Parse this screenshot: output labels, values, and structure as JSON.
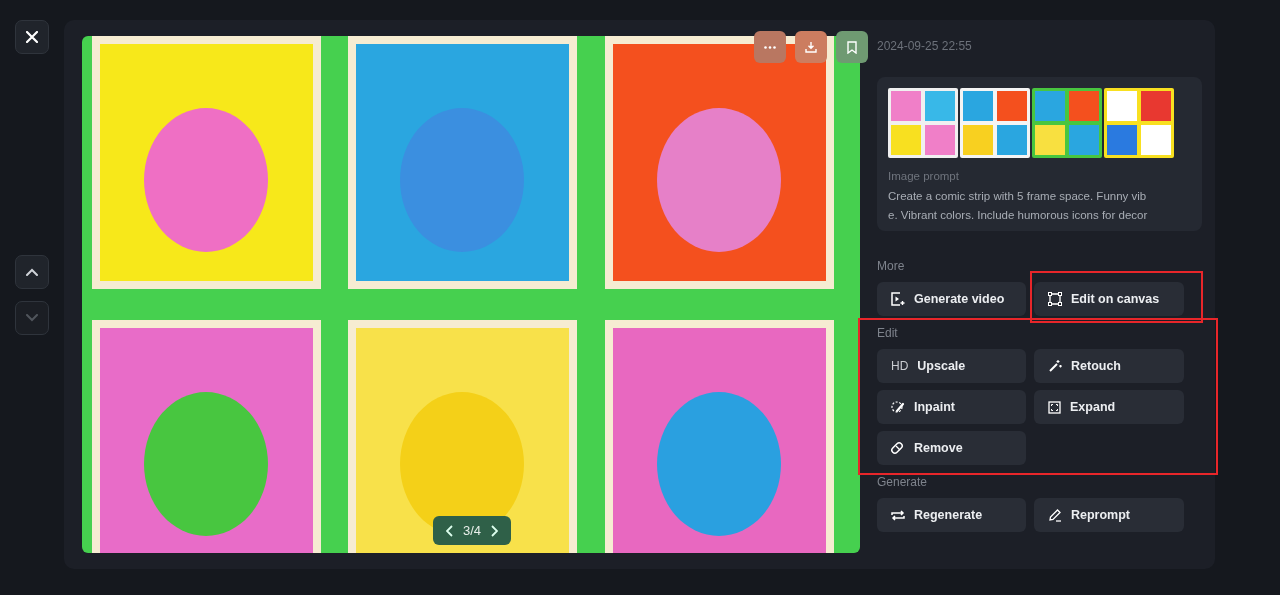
{
  "nav": {
    "up_disabled": false,
    "down_disabled": true
  },
  "viewer": {
    "pager": "3/4"
  },
  "details": {
    "date": "2024-09-25 22:55",
    "prompt_label": "Image prompt",
    "prompt_lines": [
      "Create a comic strip with 5 frame space. Funny vib",
      "e. Vibrant colors. Include humorous icons for decor"
    ]
  },
  "sections": [
    {
      "title": "More",
      "highlighted": false,
      "buttons": [
        {
          "kind": "video",
          "label": "Generate video",
          "highlighted": false
        },
        {
          "kind": "canvas",
          "label": "Edit on canvas",
          "highlighted": true
        }
      ]
    },
    {
      "title": "Edit",
      "highlighted": true,
      "buttons": [
        {
          "kind": "upscale",
          "badge": "HD",
          "label": "Upscale",
          "highlighted": false
        },
        {
          "kind": "retouch",
          "label": "Retouch",
          "highlighted": false
        },
        {
          "kind": "inpaint",
          "label": "Inpaint",
          "highlighted": false
        },
        {
          "kind": "expand",
          "label": "Expand",
          "highlighted": false
        },
        {
          "kind": "remove",
          "label": "Remove",
          "highlighted": false
        }
      ]
    },
    {
      "title": "Generate",
      "highlighted": false,
      "buttons": [
        {
          "kind": "regenerate",
          "label": "Regenerate",
          "highlighted": false
        },
        {
          "kind": "reprompt",
          "label": "Reprompt",
          "highlighted": false
        }
      ]
    }
  ]
}
